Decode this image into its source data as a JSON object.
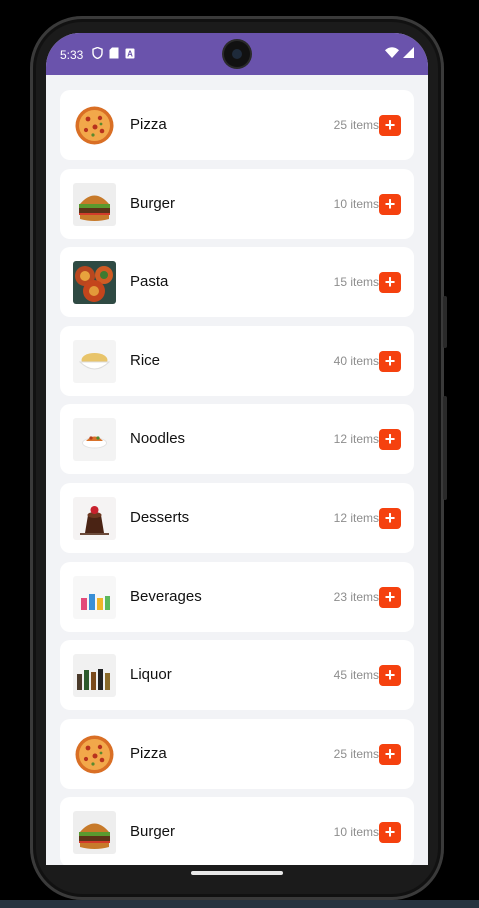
{
  "status_bar": {
    "time": "5:33",
    "left_icons": [
      "shield-icon",
      "sd-card-icon",
      "keyboard-icon"
    ],
    "right_icons": [
      "wifi-icon",
      "signal-icon"
    ],
    "color": "#6a53ac"
  },
  "colors": {
    "accent": "#f5410f",
    "background": "#f2f3f6"
  },
  "categories": [
    {
      "name": "Pizza",
      "count": "25 items",
      "add_label": "+",
      "image": "pizza"
    },
    {
      "name": "Burger",
      "count": "10 items",
      "add_label": "+",
      "image": "burger"
    },
    {
      "name": "Pasta",
      "count": "15 items",
      "add_label": "+",
      "image": "pasta"
    },
    {
      "name": "Rice",
      "count": "40 items",
      "add_label": "+",
      "image": "rice"
    },
    {
      "name": "Noodles",
      "count": "12 items",
      "add_label": "+",
      "image": "noodles"
    },
    {
      "name": "Desserts",
      "count": "12 items",
      "add_label": "+",
      "image": "dessert"
    },
    {
      "name": "Beverages",
      "count": "23 items",
      "add_label": "+",
      "image": "beverages"
    },
    {
      "name": "Liquor",
      "count": "45 items",
      "add_label": "+",
      "image": "liquor"
    },
    {
      "name": "Pizza",
      "count": "25 items",
      "add_label": "+",
      "image": "pizza"
    },
    {
      "name": "Burger",
      "count": "10 items",
      "add_label": "+",
      "image": "burger"
    }
  ]
}
